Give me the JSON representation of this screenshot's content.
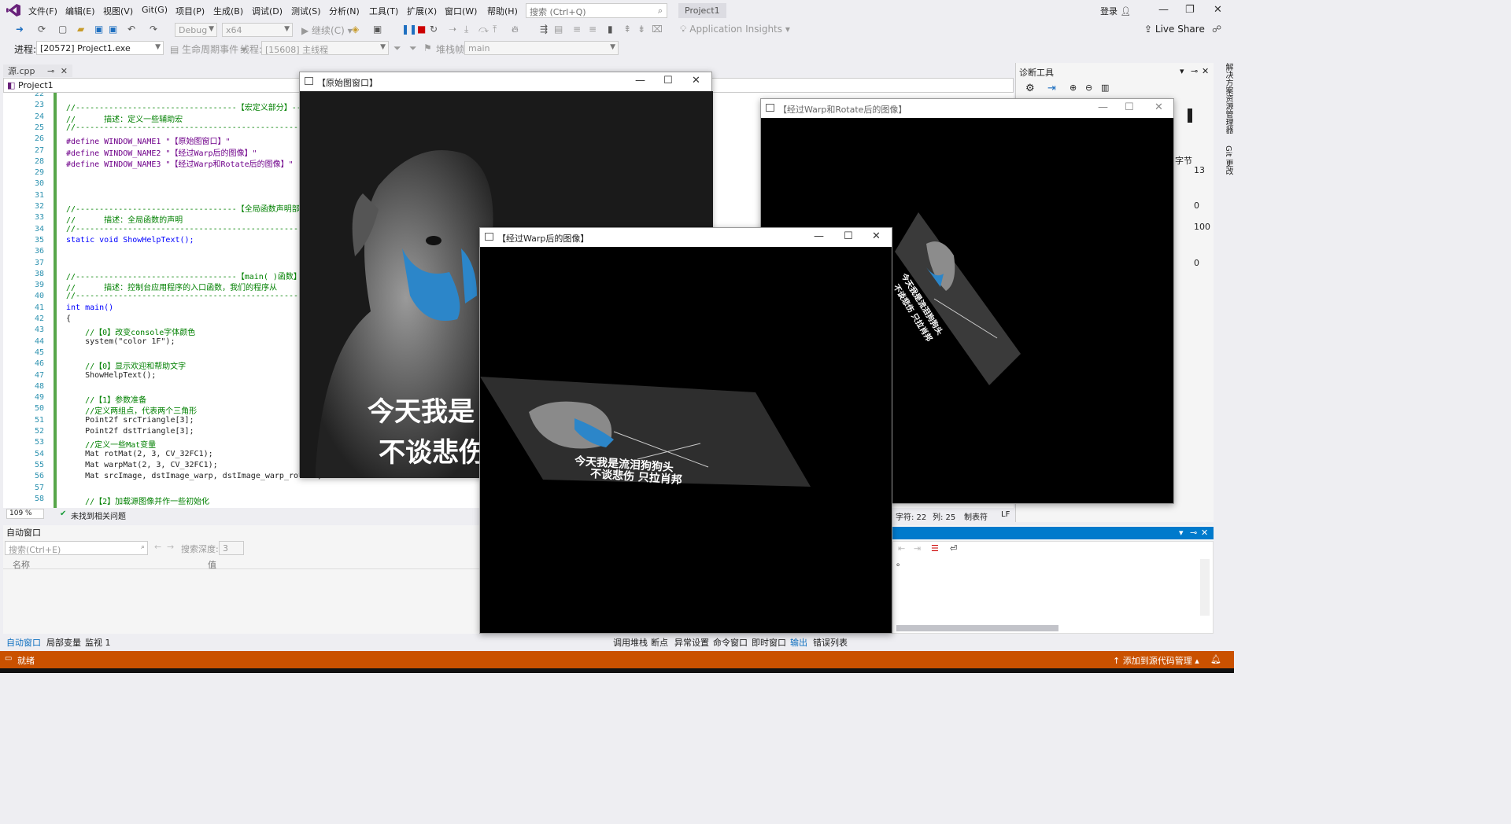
{
  "menu": [
    "文件(F)",
    "编辑(E)",
    "视图(V)",
    "Git(G)",
    "项目(P)",
    "生成(B)",
    "调试(D)",
    "测试(S)",
    "分析(N)",
    "工具(T)",
    "扩展(X)",
    "窗口(W)",
    "帮助(H)"
  ],
  "search_placeholder": "搜索 (Ctrl+Q)",
  "project_name": "Project1",
  "login_label": "登录",
  "toolbar1": {
    "config": "Debug",
    "platform": "x64",
    "continue": "继续(C)",
    "app_insights": "Application Insights",
    "live_share": "Live Share"
  },
  "toolbar2": {
    "process_label": "进程:",
    "process_value": "[20572] Project1.exe",
    "lifecycle": "生命周期事件",
    "thread_label": "线程:",
    "thread_value": "[15608] 主线程",
    "stack_label": "堆栈帧:",
    "stack_value": "main"
  },
  "editor": {
    "tab_label": "源.cpp",
    "nav_project": "Project1",
    "zoom": "109 %",
    "issues": "未找到相关问题",
    "lines": [
      {
        "n": "22",
        "t": "",
        "c": "nm"
      },
      {
        "n": "23",
        "t": "//----------------------------------【宏定义部分】--",
        "c": "cm"
      },
      {
        "n": "24",
        "t": "//      描述：定义一些辅助宏",
        "c": "cm"
      },
      {
        "n": "25",
        "t": "//--------------------------------------------------",
        "c": "cm"
      },
      {
        "n": "26",
        "t": "#define WINDOW_NAME1 \"【原始图窗口】\"",
        "c": "mac"
      },
      {
        "n": "27",
        "t": "#define WINDOW_NAME2 \"【经过Warp后的图像】\"",
        "c": "mac"
      },
      {
        "n": "28",
        "t": "#define WINDOW_NAME3 \"【经过Warp和Rotate后的图像】\"",
        "c": "mac"
      },
      {
        "n": "29",
        "t": "",
        "c": "nm"
      },
      {
        "n": "30",
        "t": "",
        "c": "nm"
      },
      {
        "n": "31",
        "t": "",
        "c": "nm"
      },
      {
        "n": "32",
        "t": "//----------------------------------【全局函数声明部",
        "c": "cm"
      },
      {
        "n": "33",
        "t": "//      描述：全局函数的声明",
        "c": "cm"
      },
      {
        "n": "34",
        "t": "//--------------------------------------------------",
        "c": "cm"
      },
      {
        "n": "35",
        "t": "static void ShowHelpText();",
        "c": "kw"
      },
      {
        "n": "36",
        "t": "",
        "c": "nm"
      },
      {
        "n": "37",
        "t": "",
        "c": "nm"
      },
      {
        "n": "38",
        "t": "//----------------------------------【main( )函数】",
        "c": "cm"
      },
      {
        "n": "39",
        "t": "//      描述：控制台应用程序的入口函数，我们的程序从",
        "c": "cm"
      },
      {
        "n": "40",
        "t": "//--------------------------------------------------",
        "c": "cm"
      },
      {
        "n": "41",
        "t": "int main()",
        "c": "kw"
      },
      {
        "n": "42",
        "t": "{",
        "c": "nm"
      },
      {
        "n": "43",
        "t": "    //【0】改变console字体颜色",
        "c": "cm"
      },
      {
        "n": "44",
        "t": "    system(\"color 1F\");",
        "c": "nm"
      },
      {
        "n": "45",
        "t": "",
        "c": "nm"
      },
      {
        "n": "46",
        "t": "    //【0】显示欢迎和帮助文字",
        "c": "cm"
      },
      {
        "n": "47",
        "t": "    ShowHelpText();",
        "c": "nm"
      },
      {
        "n": "48",
        "t": "",
        "c": "nm"
      },
      {
        "n": "49",
        "t": "    //【1】参数准备",
        "c": "cm"
      },
      {
        "n": "50",
        "t": "    //定义两组点，代表两个三角形",
        "c": "cm"
      },
      {
        "n": "51",
        "t": "    Point2f srcTriangle[3];",
        "c": "nm"
      },
      {
        "n": "52",
        "t": "    Point2f dstTriangle[3];",
        "c": "nm"
      },
      {
        "n": "53",
        "t": "    //定义一些Mat变量",
        "c": "cm"
      },
      {
        "n": "54",
        "t": "    Mat rotMat(2, 3, CV_32FC1);",
        "c": "nm"
      },
      {
        "n": "55",
        "t": "    Mat warpMat(2, 3, CV_32FC1);",
        "c": "nm"
      },
      {
        "n": "56",
        "t": "    Mat srcImage, dstImage_warp, dstImage_warp_rotate;",
        "c": "nm"
      },
      {
        "n": "57",
        "t": "",
        "c": "nm"
      },
      {
        "n": "58",
        "t": "    //【2】加载源图像并作一些初始化",
        "c": "cm"
      }
    ]
  },
  "diag": {
    "title": "诊断工具",
    "unit": "字节",
    "v13": "13",
    "v0a": "0",
    "v100": "100",
    "v0b": "0",
    "side_tabs": [
      "解决方案资源管理器",
      "Git 更改"
    ]
  },
  "statusline": {
    "char": "字符: 22",
    "col": "列: 25",
    "tab": "制表符",
    "eol": "LF"
  },
  "autowin": {
    "title": "自动窗口",
    "search_placeholder": "搜索(Ctrl+E)",
    "depth_label": "搜索深度:",
    "depth_value": "3",
    "col_name": "名称",
    "col_value": "值"
  },
  "bottom_tabs_left": [
    "自动窗口",
    "局部变量",
    "监视 1"
  ],
  "bottom_tabs_right": [
    "调用堆栈",
    "断点",
    "异常设置",
    "命令窗口",
    "即时窗口",
    "输出",
    "错误列表"
  ],
  "status": {
    "ready": "就绪",
    "source_control": "添加到源代码管理"
  },
  "windows": {
    "orig_title": "【原始图窗口】",
    "warp_title": "【经过Warp后的图像】",
    "rotate_title": "【经过Warp和Rotate后的图像】",
    "caption_line1": "今天我是流泪狗狗头",
    "caption_line2": "不谈悲伤 只拉肖邦",
    "orig_caption_line1": "今天我是",
    "orig_caption_line2": "不谈悲伤"
  },
  "colors": {
    "accent": "#007acc",
    "status_bar": "#ca5100",
    "comment": "#008000",
    "keyword": "#0000ff",
    "macro": "#6f008a"
  }
}
